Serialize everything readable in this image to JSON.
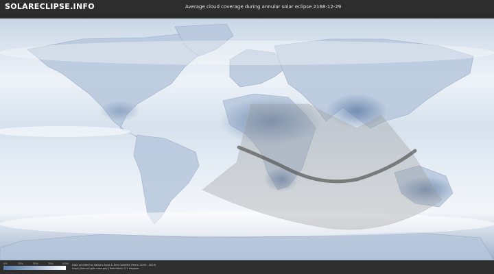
{
  "header": {
    "logo_part1": "SOLAR",
    "logo_part2": "ECLIPSE.INFO",
    "title": "Average cloud coverage during annular solar eclipse 2168-12-29"
  },
  "legend": {
    "ticks": [
      "0%",
      "25%",
      "50%",
      "75%",
      "100%"
    ],
    "gradient_colors": [
      "#5b7ba7",
      "#ffffff"
    ]
  },
  "footer": {
    "credit_line1": "Data provided by NASA's Aqua & Terra satellite (Years: 2000 - 2019)",
    "credit_line2": "https://neo.sci.gsfc.nasa.gov | Resolution: 0.1 degrees"
  },
  "colors": {
    "ocean": "#dde7f1",
    "cloud_low": "#5b7ba7",
    "cloud_high": "#ffffff",
    "eclipse_zone": "#9a9a9a",
    "central_path": "#555555"
  }
}
